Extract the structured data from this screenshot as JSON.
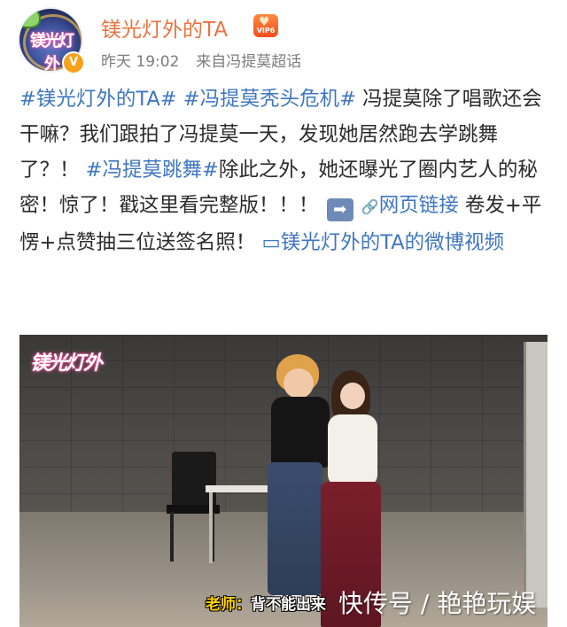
{
  "post": {
    "author": "镁光灯外的TA",
    "avatar_text": "镁光灯外",
    "avatar_badge": "V",
    "vip_level": "VIP6",
    "time": "昨天 19:02",
    "source_prefix": "来自",
    "source": "冯提莫超话",
    "body": {
      "tag1": "#镁光灯外的TA#",
      "tag2": "#冯提莫秃头危机#",
      "text1": " 冯提莫除了唱歌还会干嘛？我们跟拍了冯提莫一天，发现她居然跑去学跳舞了？！",
      "tag3": "#冯提莫跳舞#",
      "text2": "除此之外，她还曝光了圈内艺人的秘密！惊了！戳这里看完整版！！！",
      "arrow": "➡",
      "link_icon": "🔗",
      "link_label": "网页链接",
      "text3": " 卷发+平愣+点赞抽三位送签名照！",
      "video_icon": "▭",
      "video_link": "镁光灯外的TA的微博视频"
    }
  },
  "video": {
    "logo_text": "镁光灯外",
    "subtitle_label": "老师：",
    "subtitle_text": "背不能出来",
    "watermark": "快传号 / 艳艳玩娱"
  },
  "colors": {
    "name": "#eb7340",
    "link": "#3f76c2",
    "meta": "#7d7d7d"
  }
}
